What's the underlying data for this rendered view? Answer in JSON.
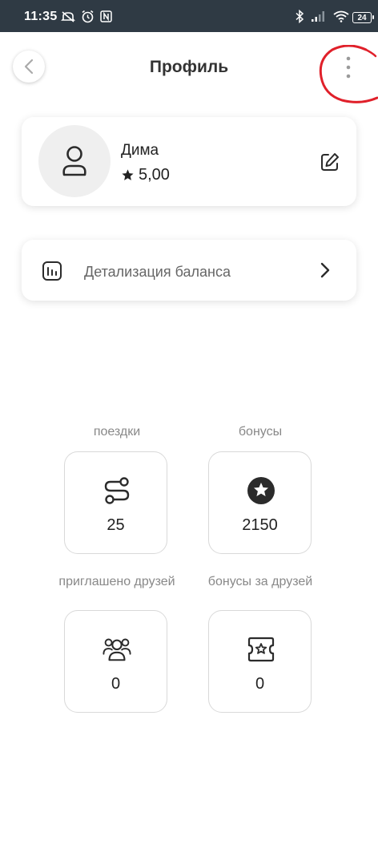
{
  "status_bar": {
    "time": "11:35",
    "battery": "24",
    "left_icons": [
      "mute-icon",
      "alarm-icon",
      "nfc-icon"
    ],
    "right_icons": [
      "bluetooth-icon",
      "signal-icon",
      "wifi-icon"
    ]
  },
  "header": {
    "title": "Профиль"
  },
  "profile": {
    "name": "Дима",
    "rating": "5,00"
  },
  "balance": {
    "label": "Детализация баланса"
  },
  "stats": [
    {
      "label": "поездки",
      "value": "25",
      "icon": "route-icon"
    },
    {
      "label": "бонусы",
      "value": "2150",
      "icon": "star-badge-icon"
    },
    {
      "label": "приглашено друзей",
      "value": "0",
      "icon": "friends-icon"
    },
    {
      "label": "бонусы за друзей",
      "value": "0",
      "icon": "ticket-star-icon"
    }
  ],
  "colors": {
    "status_bar": "#2f3a44",
    "annotation_circle": "#e0202a",
    "text_primary": "#222222",
    "text_secondary": "#888888"
  }
}
